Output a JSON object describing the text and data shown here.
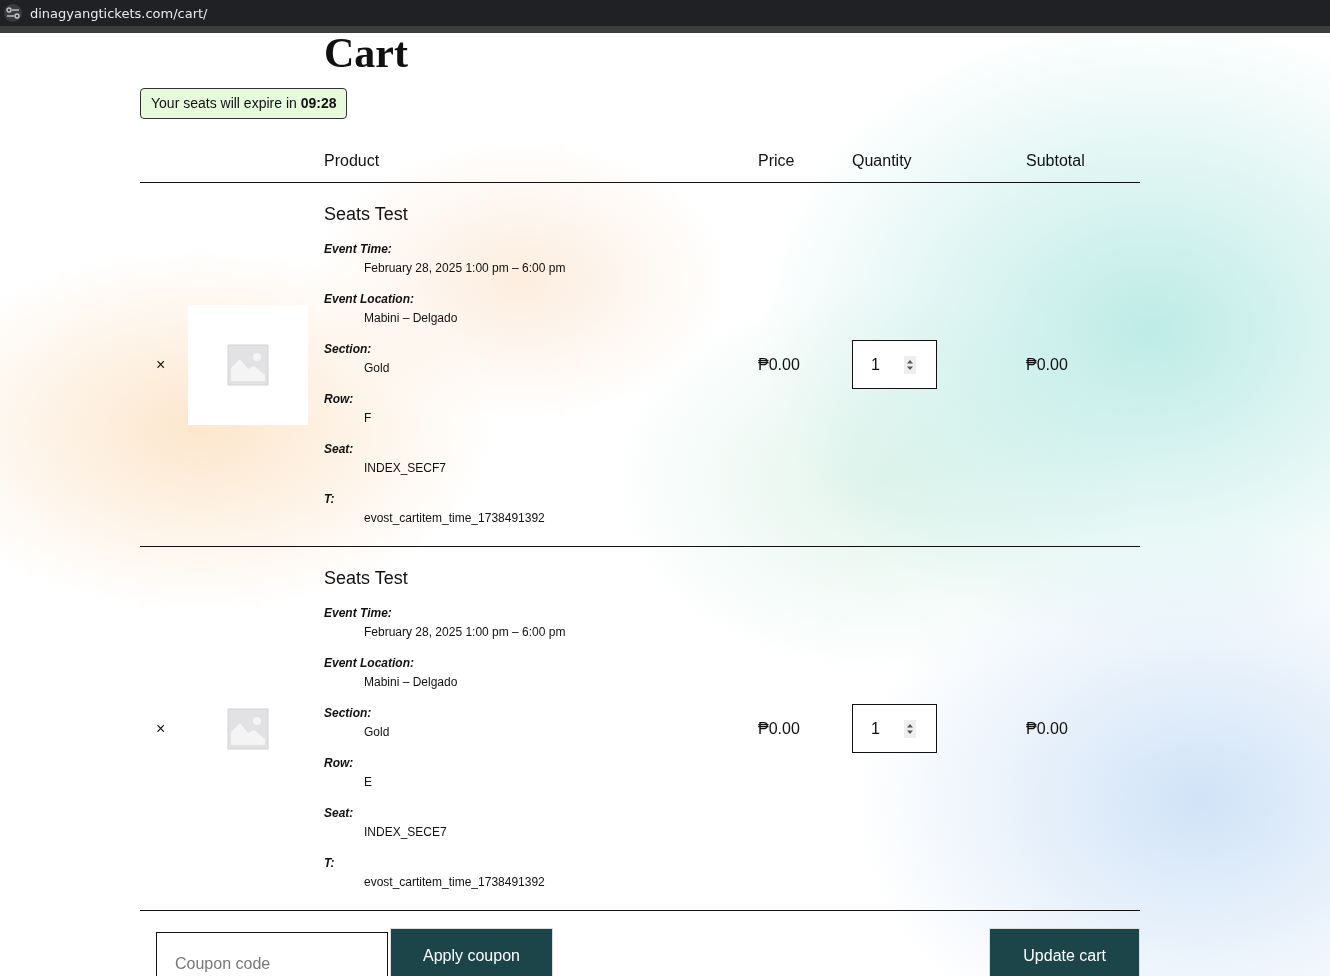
{
  "browser": {
    "url": "dinagyangtickets.com/cart/"
  },
  "page": {
    "title": "Cart"
  },
  "timer": {
    "text": "Your seats will expire in **09:28**"
  },
  "cart": {
    "columns": [
      "Product",
      "Price",
      "Quantity",
      "Subtotal"
    ],
    "items": [
      {
        "remove": "×",
        "name": "Seats Test",
        "meta": [
          {
            "label": "Event Time:",
            "value": "February 28, 2025 1:00 pm – 6:00 pm"
          },
          {
            "label": "Event Location:",
            "value": "Mabini – Delgado"
          },
          {
            "label": "Section:",
            "value": "Gold"
          },
          {
            "label": "Row:",
            "value": "F"
          },
          {
            "label": "Seat:",
            "value": "INDEX_SECF7"
          },
          {
            "label": "T:",
            "value": "evost_cartitem_time_1738491392"
          }
        ],
        "price": "₱0.00",
        "quantity": "1",
        "subtotal": "₱0.00"
      },
      {
        "remove": "×",
        "name": "Seats Test",
        "meta": [
          {
            "label": "Event Time:",
            "value": "February 28, 2025 1:00 pm – 6:00 pm"
          },
          {
            "label": "Event Location:",
            "value": "Mabini – Delgado"
          },
          {
            "label": "Section:",
            "value": "Gold"
          },
          {
            "label": "Row:",
            "value": "E"
          },
          {
            "label": "Seat:",
            "value": "INDEX_SECE7"
          },
          {
            "label": "T:",
            "value": "evost_cartitem_time_1738491392"
          }
        ],
        "price": "₱0.00",
        "quantity": "1",
        "subtotal": "₱0.00"
      }
    ]
  },
  "coupon": {
    "placeholder": "Coupon code",
    "button": "Apply coupon"
  },
  "update_button": "Update cart"
}
